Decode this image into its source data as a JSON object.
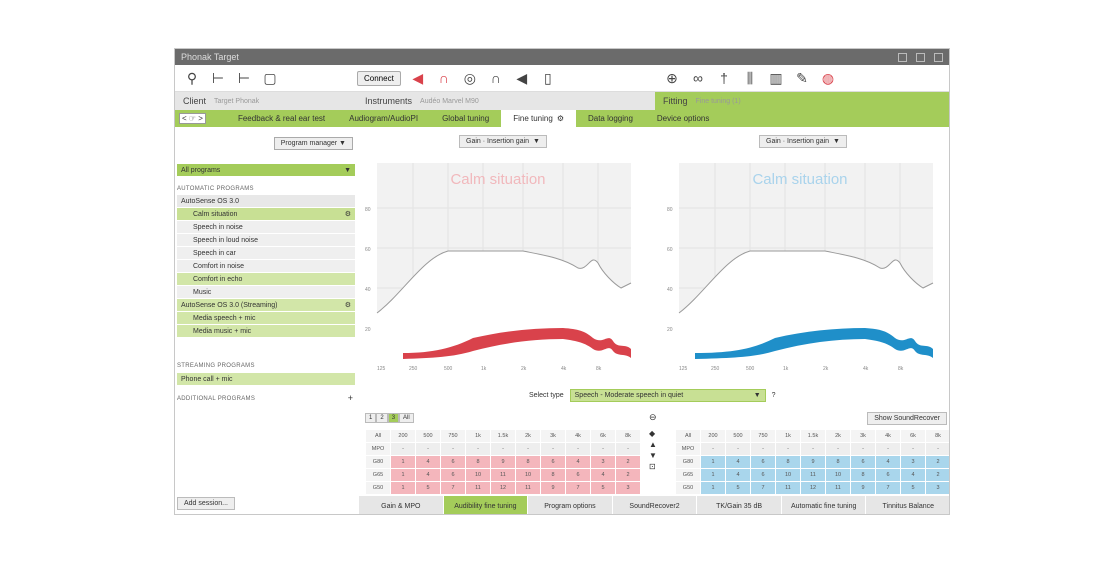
{
  "window": {
    "title": "Phonak Target",
    "links": [
      "",
      ""
    ],
    "right_text": ""
  },
  "toolbar": {
    "connect": "Connect"
  },
  "info": {
    "client_label": "Client",
    "client_value": "Target Phonak",
    "instruments_label": "Instruments",
    "instruments_value": "Audéo Marvel M90",
    "fitting_label": "Fitting",
    "fitting_value": "Fine tuning (1)"
  },
  "nav": {
    "arrows": "< ☞ >",
    "items": [
      "Feedback & real ear test",
      "Audiogram/AudioPI",
      "Global tuning",
      "Fine tuning",
      "Data logging",
      "Device options"
    ],
    "active_index": 3
  },
  "sidebar": {
    "program_manager": "Program manager ▼",
    "all_programs": "All programs",
    "auto_title": "AUTOMATIC PROGRAMS",
    "autosense": "AutoSense OS 3.0",
    "programs": [
      "Calm situation",
      "Speech in noise",
      "Speech in loud noise",
      "Speech in car",
      "Comfort in noise",
      "Comfort in echo",
      "Music"
    ],
    "streaming_head": "AutoSense OS 3.0 (Streaming)",
    "streaming_items": [
      "Media speech + mic",
      "Media music + mic"
    ],
    "stream_title": "STREAMING PROGRAMS",
    "stream_item": "Phone call + mic",
    "additional_title": "ADDITIONAL PROGRAMS",
    "add_session": "Add session..."
  },
  "charts": {
    "left": {
      "select": "Gain · Insertion gain",
      "title": "Calm situation"
    },
    "right": {
      "select": "Gain · Insertion gain",
      "title": "Calm situation"
    },
    "xticks": [
      "125",
      "250",
      "500",
      "1k",
      "2k",
      "4k",
      "8k"
    ],
    "yticks": [
      "80",
      "60",
      "40",
      "20"
    ]
  },
  "selecttype": {
    "label": "Select type",
    "value": "Speech - Moderate speech in quiet"
  },
  "gaintabs": [
    "1",
    "2",
    "3",
    "All"
  ],
  "showsound": "Show SoundRecover",
  "table": {
    "head": [
      "All",
      "200",
      "500",
      "750",
      "1k",
      "1.5k",
      "2k",
      "3k",
      "4k",
      "6k",
      "8k"
    ],
    "rows": [
      "MPO",
      "G80",
      "G65",
      "G50"
    ],
    "left_vals": [
      [
        "-",
        "-",
        "-",
        "-",
        "-",
        "-",
        "-",
        "-",
        "-",
        "-"
      ],
      [
        "1",
        "4",
        "6",
        "8",
        "9",
        "8",
        "6",
        "4",
        "3",
        "2"
      ],
      [
        "1",
        "4",
        "6",
        "10",
        "11",
        "10",
        "8",
        "6",
        "4",
        "2"
      ],
      [
        "1",
        "5",
        "7",
        "11",
        "12",
        "11",
        "9",
        "7",
        "5",
        "3"
      ]
    ],
    "right_vals": [
      [
        "-",
        "-",
        "-",
        "-",
        "-",
        "-",
        "-",
        "-",
        "-",
        "-"
      ],
      [
        "1",
        "4",
        "6",
        "8",
        "9",
        "8",
        "6",
        "4",
        "3",
        "2"
      ],
      [
        "1",
        "4",
        "6",
        "10",
        "11",
        "10",
        "8",
        "6",
        "4",
        "2"
      ],
      [
        "1",
        "5",
        "7",
        "11",
        "12",
        "11",
        "9",
        "7",
        "5",
        "3"
      ]
    ]
  },
  "bottomtabs": [
    "Gain & MPO",
    "Audibility fine tuning",
    "Program options",
    "SoundRecover2",
    "TK/Gain 35 dB",
    "Automatic fine tuning",
    "Tinnitus Balance"
  ],
  "bottom_active": 1,
  "colors": {
    "accent": "#a4cc5a",
    "left": "#d9424b",
    "right": "#1f8fc9"
  }
}
